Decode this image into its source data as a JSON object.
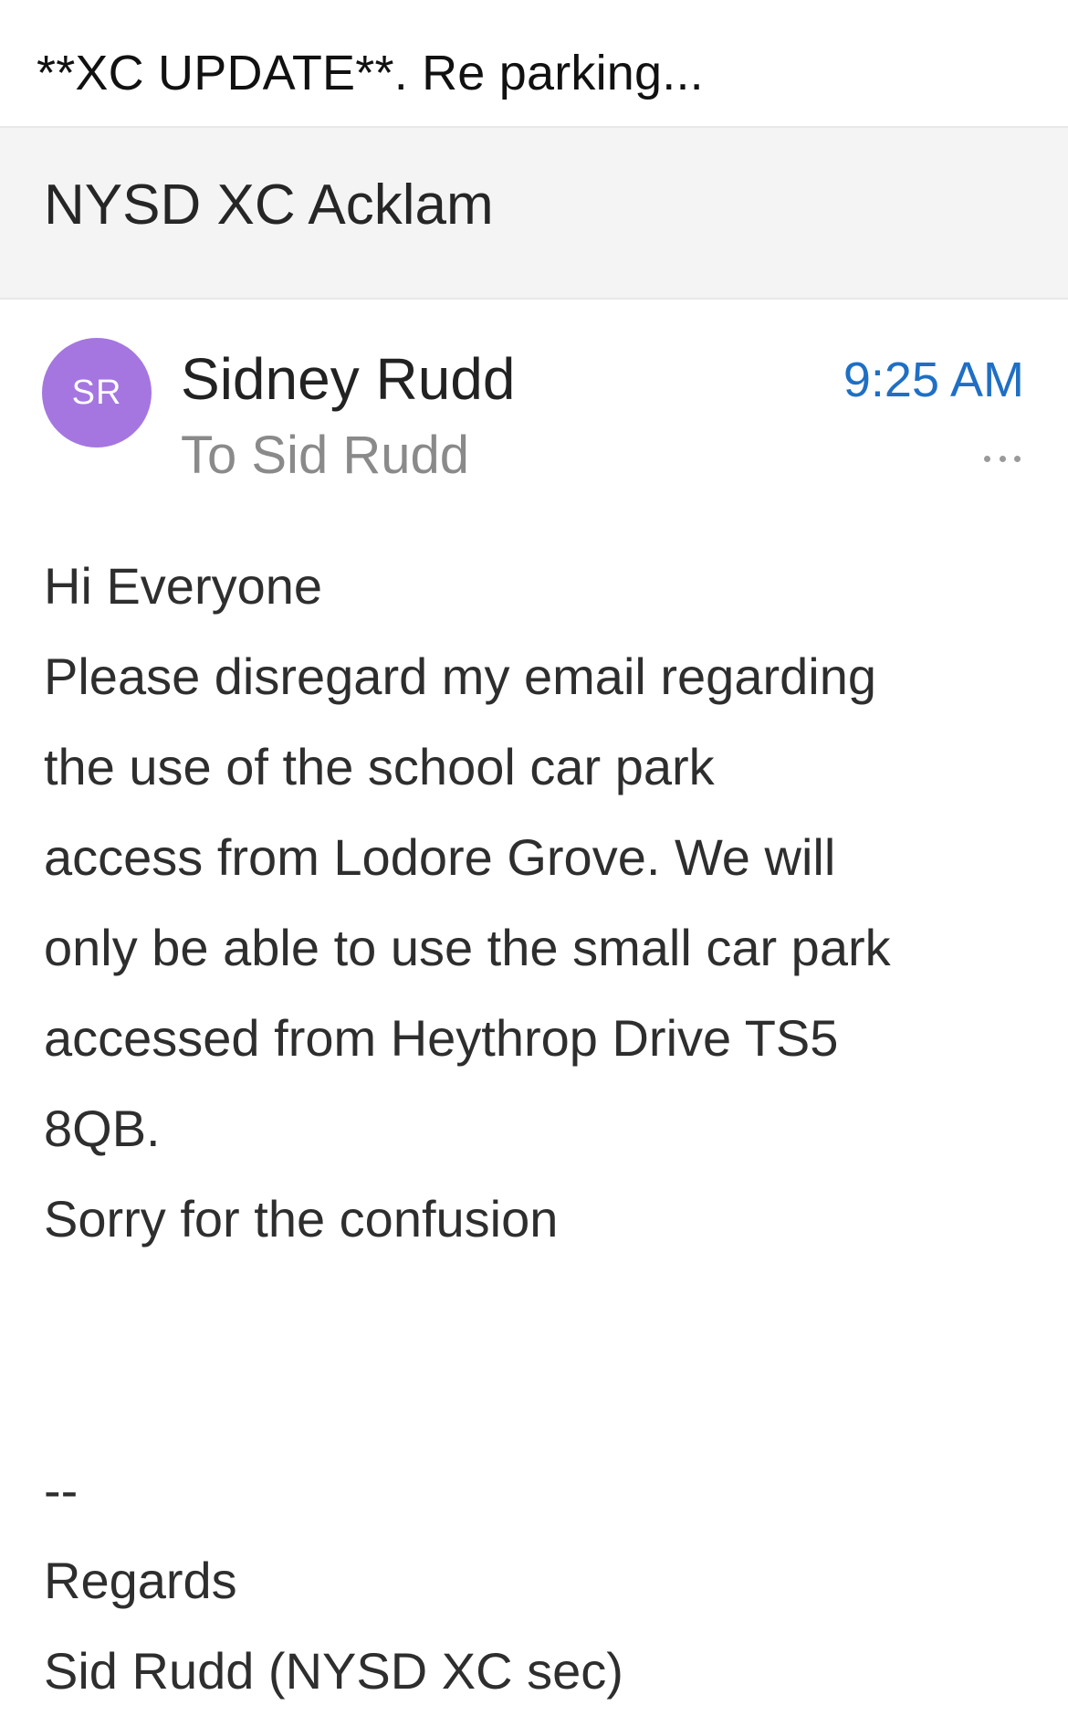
{
  "post": {
    "title": "**XC UPDATE**. Re parking..."
  },
  "email": {
    "subject": "NYSD XC Acklam",
    "sender": {
      "initials": "SR",
      "name": "Sidney Rudd",
      "to": "To Sid Rudd",
      "avatar_color": "#a576e0"
    },
    "time": "9:25 AM",
    "time_color": "#1f6fc4",
    "more_icon": "ellipsis-icon",
    "body": {
      "greeting": "Hi Everyone",
      "line1": "Please disregard my email regarding",
      "line2": "the use of the school car park",
      "line3": "access from Lodore Grove. We will",
      "line4": "only be able to use the small car park",
      "line5": "accessed from Heythrop Drive TS5",
      "line6": "8QB.",
      "apology": "Sorry for the confusion",
      "separator": "--",
      "signoff": "Regards",
      "signature": "Sid Rudd (NYSD XC sec)"
    }
  }
}
